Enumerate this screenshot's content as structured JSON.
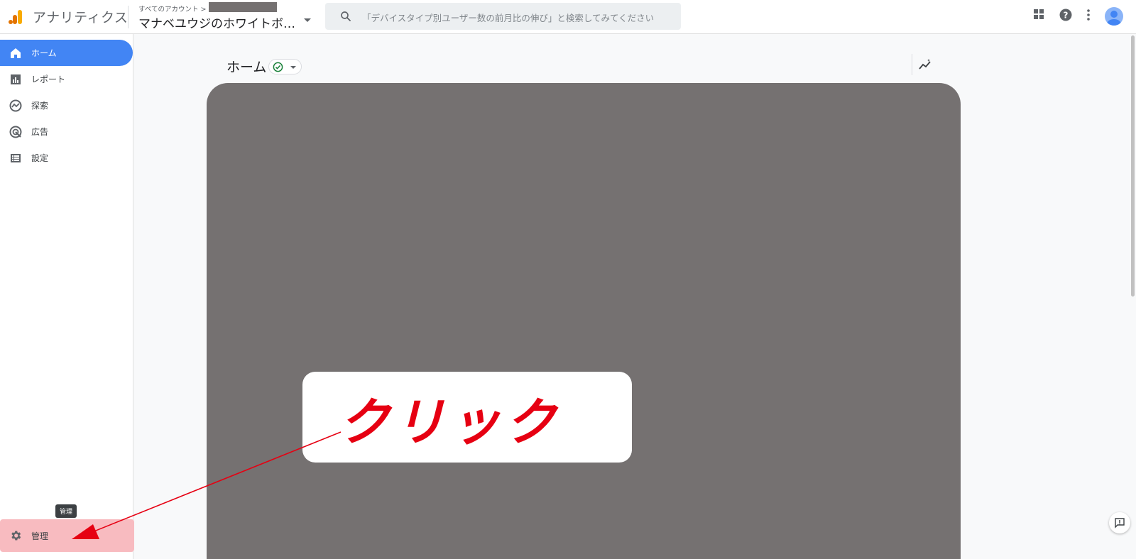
{
  "header": {
    "app_title": "アナリティクス",
    "breadcrumb": "すべてのアカウント >",
    "account_name": "マナベユウジのホワイトボ…",
    "search_placeholder": "「デバイスタイプ別ユーザー数の前月比の伸び」と検索してみてください"
  },
  "sidebar": {
    "items": [
      {
        "label": "ホーム",
        "icon": "home-icon",
        "active": true
      },
      {
        "label": "レポート",
        "icon": "bar-chart-icon"
      },
      {
        "label": "探索",
        "icon": "explore-icon"
      },
      {
        "label": "広告",
        "icon": "ads-target-icon"
      },
      {
        "label": "設定",
        "icon": "list-icon"
      }
    ],
    "admin_label": "管理",
    "admin_tooltip": "管理"
  },
  "main": {
    "page_title": "ホーム"
  },
  "annotation": {
    "callout_text": "クリック",
    "callout_color": "#e60012",
    "highlight_color": "#f8bbc0"
  },
  "colors": {
    "accent": "#4285f4",
    "panel": "#757171"
  }
}
